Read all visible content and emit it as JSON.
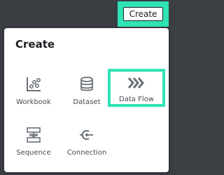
{
  "toolbar": {
    "create_label": "Create"
  },
  "menu": {
    "title": "Create",
    "items": [
      {
        "label": "Workbook",
        "icon": "workbook-scatter-icon"
      },
      {
        "label": "Dataset",
        "icon": "database-icon"
      },
      {
        "label": "Data Flow",
        "icon": "chevrons-right-icon"
      },
      {
        "label": "Sequence",
        "icon": "sequence-icon"
      },
      {
        "label": "Connection",
        "icon": "connection-plug-icon"
      }
    ]
  },
  "colors": {
    "highlight": "#2fe3b5",
    "background": "#3a3e43",
    "icon": "#6b7178",
    "text": "#444a52"
  }
}
